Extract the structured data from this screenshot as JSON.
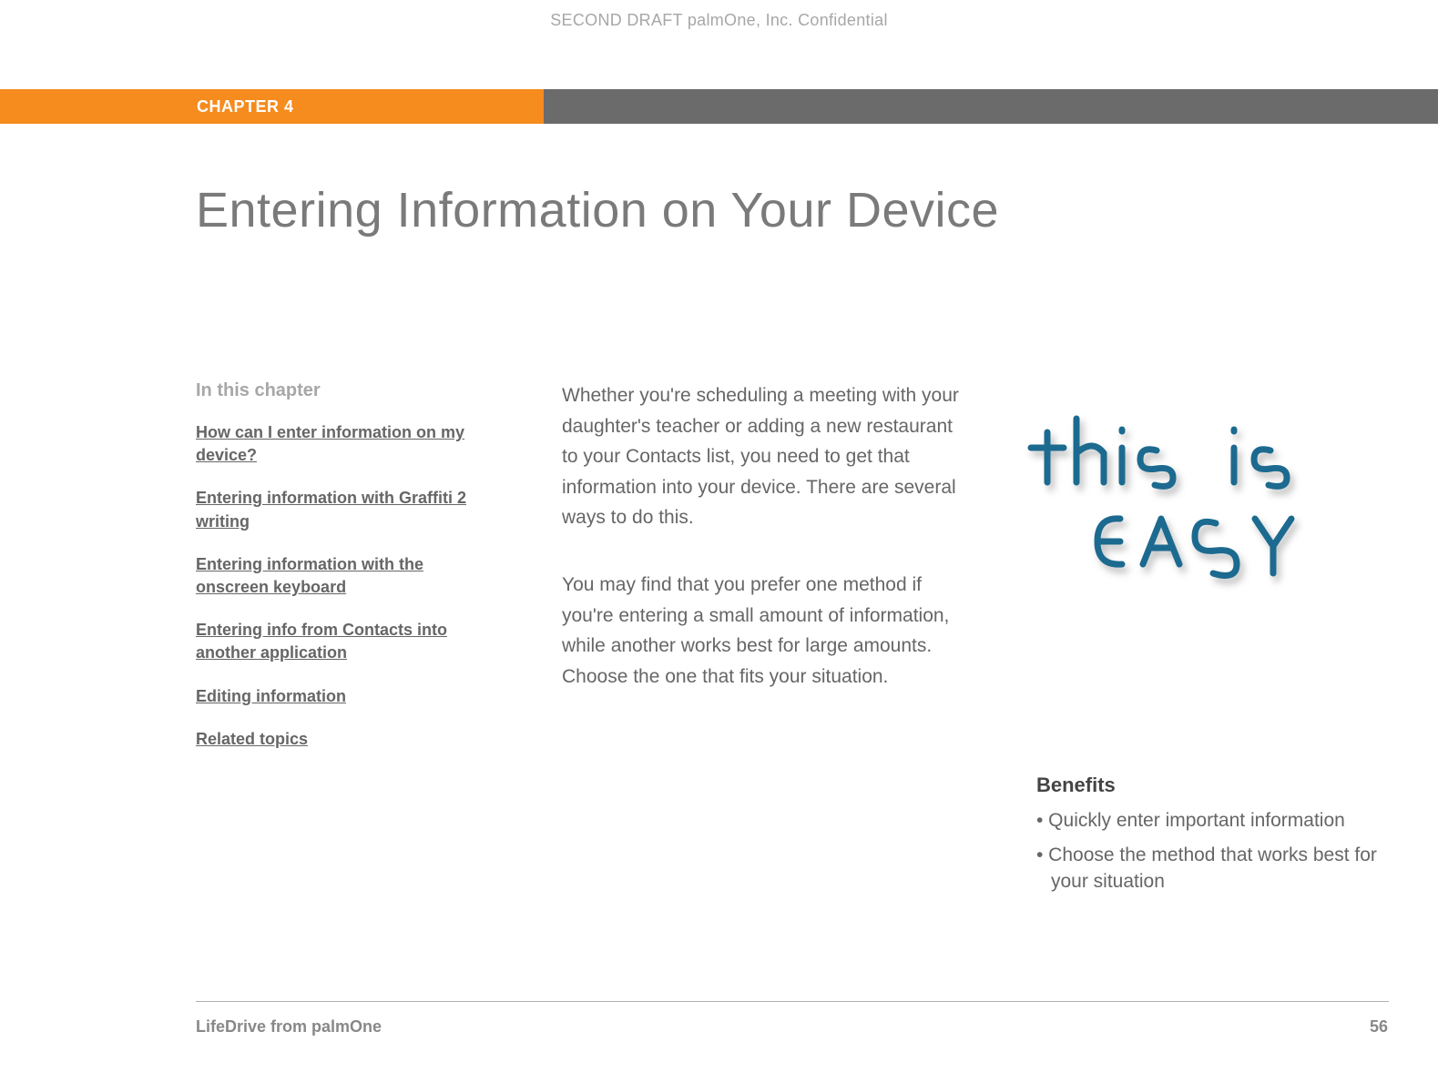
{
  "header": {
    "confidential": "SECOND DRAFT palmOne, Inc.  Confidential"
  },
  "chapter": {
    "label": "CHAPTER 4"
  },
  "title": "Entering Information on Your Device",
  "sidebar": {
    "heading": "In this chapter",
    "links": [
      "How can I enter information on my device?",
      "Entering information with Graffiti 2 writing",
      "Entering information with the onscreen keyboard",
      "Entering info from Contacts into another application",
      "Editing information",
      "Related topics"
    ]
  },
  "main": {
    "p1": "Whether you're scheduling a meeting with your daughter's teacher or adding a new restaurant to your Contacts list, you need to get that information into your device. There are several ways to do this.",
    "p2": "You may find that you prefer one method if you're entering a small amount of information, while another works best for large amounts. Choose the one that fits your situation."
  },
  "graphic": {
    "line1": "this is",
    "line2": "EASY"
  },
  "benefits": {
    "heading": "Benefits",
    "items": [
      "• Quickly enter important information",
      "• Choose the method that works best for your situation"
    ]
  },
  "footer": {
    "product": "LifeDrive from palmOne",
    "page": "56"
  }
}
